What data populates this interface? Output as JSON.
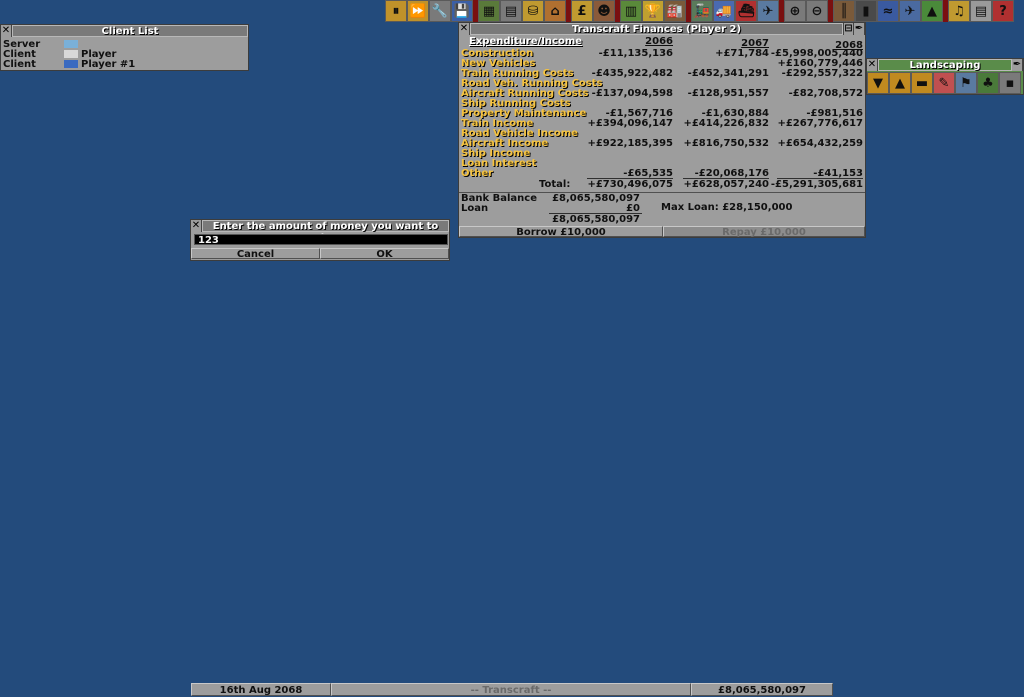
{
  "toolbar": {
    "buttons": [
      {
        "name": "pause-icon",
        "glyph": "⏸",
        "bg": "#c0922a"
      },
      {
        "name": "fast-forward-icon",
        "glyph": "⏩",
        "bg": "#c0922a"
      },
      {
        "name": "settings-wrench-icon",
        "glyph": "🔧",
        "bg": "#7a7a7a"
      },
      {
        "name": "save-disk-icon",
        "glyph": "💾",
        "bg": "#3b5fa6"
      },
      {
        "name": "sep",
        "glyph": "",
        "bg": "#7a1010"
      },
      {
        "name": "map-icon",
        "glyph": "▦",
        "bg": "#5a7a3a"
      },
      {
        "name": "town-directory-icon",
        "glyph": "▤",
        "bg": "#7a7a7a"
      },
      {
        "name": "subsidies-icon",
        "glyph": "⛁",
        "bg": "#c09a30"
      },
      {
        "name": "stations-icon",
        "glyph": "⌂",
        "bg": "#b07030"
      },
      {
        "name": "sep",
        "glyph": "",
        "bg": "#7a1010"
      },
      {
        "name": "finances-icon",
        "glyph": "£",
        "bg": "#c09a30"
      },
      {
        "name": "company-manager-icon",
        "glyph": "☻",
        "bg": "#8a5a3a"
      },
      {
        "name": "sep",
        "glyph": "",
        "bg": "#7a1010"
      },
      {
        "name": "graphs-icon",
        "glyph": "▥",
        "bg": "#5a8a3a"
      },
      {
        "name": "league-trophy-icon",
        "glyph": "🏆",
        "bg": "#c0a030"
      },
      {
        "name": "industry-icon",
        "glyph": "🏭",
        "bg": "#7a5a3a"
      },
      {
        "name": "sep",
        "glyph": "",
        "bg": "#7a1010"
      },
      {
        "name": "trains-icon",
        "glyph": "🚂",
        "bg": "#5a7a5a"
      },
      {
        "name": "road-vehicles-icon",
        "glyph": "🚚",
        "bg": "#4a6ab0"
      },
      {
        "name": "ships-icon",
        "glyph": "⛴",
        "bg": "#b03030"
      },
      {
        "name": "aircraft-icon",
        "glyph": "✈",
        "bg": "#5a7aa0"
      },
      {
        "name": "sep",
        "glyph": "",
        "bg": "#7a1010"
      },
      {
        "name": "zoom-in-icon",
        "glyph": "⊕",
        "bg": "#7a7a7a"
      },
      {
        "name": "zoom-out-icon",
        "glyph": "⊖",
        "bg": "#7a7a7a"
      },
      {
        "name": "sep",
        "glyph": "",
        "bg": "#7a1010"
      },
      {
        "name": "build-rail-icon",
        "glyph": "║",
        "bg": "#7a5a3a"
      },
      {
        "name": "build-road-icon",
        "glyph": "▮",
        "bg": "#4a4a4a"
      },
      {
        "name": "build-water-icon",
        "glyph": "≈",
        "bg": "#3a5aa0"
      },
      {
        "name": "build-airport-icon",
        "glyph": "✈",
        "bg": "#4a6aa0"
      },
      {
        "name": "landscaping-icon",
        "glyph": "▲",
        "bg": "#4a8a3a"
      },
      {
        "name": "sep",
        "glyph": "",
        "bg": "#7a1010"
      },
      {
        "name": "music-icon",
        "glyph": "♫",
        "bg": "#c09a30"
      },
      {
        "name": "news-icon",
        "glyph": "▤",
        "bg": "#9a9a9a"
      },
      {
        "name": "help-icon",
        "glyph": "?",
        "bg": "#b03030"
      }
    ]
  },
  "client_list": {
    "title": "Client List",
    "rows": [
      {
        "role": "Server",
        "name": ""
      },
      {
        "role": "Client",
        "name": "Player"
      },
      {
        "role": "Client",
        "name": "Player #1"
      }
    ]
  },
  "finances": {
    "title": "Transcraft Finances (Player 2)",
    "header": "Expenditure/Income",
    "years": [
      "2066",
      "2067",
      "2068"
    ],
    "rows": [
      {
        "label": "Construction",
        "v": [
          "-£11,135,136",
          "+£71,784",
          "-£5,998,005,440"
        ]
      },
      {
        "label": "New Vehicles",
        "v": [
          "",
          "",
          "+£160,779,446"
        ]
      },
      {
        "label": "Train Running Costs",
        "v": [
          "-£435,922,482",
          "-£452,341,291",
          "-£292,557,322"
        ]
      },
      {
        "label": "Road Veh. Running Costs",
        "v": [
          "",
          "",
          ""
        ]
      },
      {
        "label": "Aircraft Running Costs",
        "v": [
          "-£137,094,598",
          "-£128,951,557",
          "-£82,708,572"
        ]
      },
      {
        "label": "Ship Running Costs",
        "v": [
          "",
          "",
          ""
        ]
      },
      {
        "label": "Property Maintenance",
        "v": [
          "-£1,567,716",
          "-£1,630,884",
          "-£981,516"
        ]
      },
      {
        "label": "Train Income",
        "v": [
          "+£394,096,147",
          "+£414,226,832",
          "+£267,776,617"
        ]
      },
      {
        "label": "Road Vehicle Income",
        "v": [
          "",
          "",
          ""
        ]
      },
      {
        "label": "Aircraft Income",
        "v": [
          "+£922,185,395",
          "+£816,750,532",
          "+£654,432,259"
        ]
      },
      {
        "label": "Ship Income",
        "v": [
          "",
          "",
          ""
        ]
      },
      {
        "label": "Loan Interest",
        "v": [
          "",
          "",
          ""
        ]
      },
      {
        "label": "Other",
        "v": [
          "-£65,535",
          "-£20,068,176",
          "-£41,153"
        ]
      }
    ],
    "total_label": "Total:",
    "totals": [
      "+£730,496,075",
      "+£628,057,240",
      "-£5,291,305,681"
    ],
    "bank_balance_label": "Bank Balance",
    "bank_balance": "£8,065,580,097",
    "loan_label": "Loan",
    "loan": "£0",
    "net": "£8,065,580,097",
    "max_loan_label": "Max Loan: £28,150,000",
    "borrow_label": "Borrow £10,000",
    "repay_label": "Repay £10,000"
  },
  "landscaping": {
    "title": "Landscaping",
    "buttons": [
      {
        "name": "lower-land-icon",
        "glyph": "▼",
        "bg": "#c08a20"
      },
      {
        "name": "raise-land-icon",
        "glyph": "▲",
        "bg": "#c08a20"
      },
      {
        "name": "level-land-icon",
        "glyph": "▬",
        "bg": "#c08a20"
      },
      {
        "name": "demolish-icon",
        "glyph": "✎",
        "bg": "#c05050"
      },
      {
        "name": "buy-land-icon",
        "glyph": "⚑",
        "bg": "#5a7aa0"
      },
      {
        "name": "plant-trees-icon",
        "glyph": "♣",
        "bg": "#4a7a3a"
      },
      {
        "name": "place-sign-icon",
        "glyph": "▪",
        "bg": "#7a7a7a"
      }
    ]
  },
  "give_money": {
    "title": "Enter the amount of money you want to give",
    "value": "123",
    "cancel_label": "Cancel",
    "ok_label": "OK"
  },
  "status_bar": {
    "date": "16th Aug 2068",
    "company": "-- Transcraft --",
    "money": "£8,065,580,097"
  }
}
